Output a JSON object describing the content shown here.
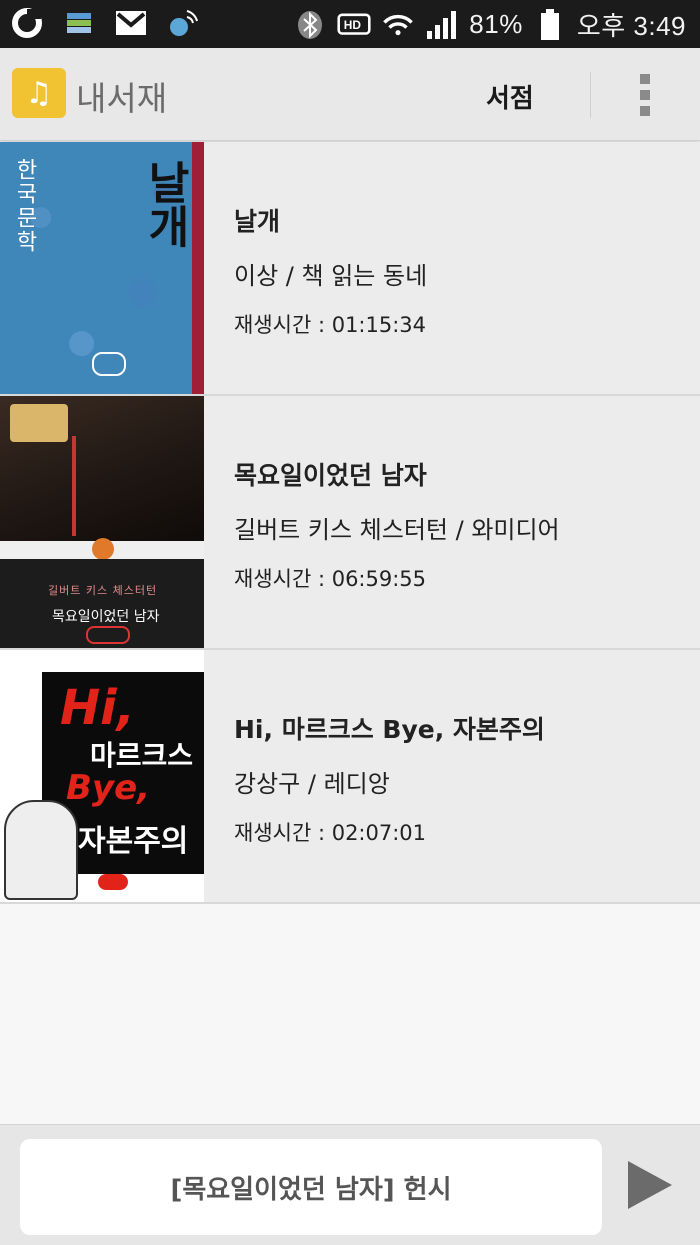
{
  "status_bar": {
    "battery_percent": "81%",
    "time": "오후 3:49",
    "icons": [
      "o-app-icon",
      "sync-icon",
      "gmail-icon",
      "signal-app-icon",
      "bluetooth-icon",
      "hd-icon",
      "wifi-icon",
      "cell-signal-icon",
      "battery-icon"
    ]
  },
  "app_bar": {
    "title": "내서재",
    "store_label": "서점",
    "logo_icon": "music-book-icon",
    "menu_icon": "overflow-menu-icon"
  },
  "books": [
    {
      "title": "날개",
      "author": "이상 / 책 읽는 동네",
      "play_time": "재생시간 : 01:15:34",
      "cover": {
        "series": "한국문학",
        "title": "날개"
      }
    },
    {
      "title": "목요일이었던 남자",
      "author": "길버트 키스 체스터턴 / 와미디어",
      "play_time": "재생시간 : 06:59:55",
      "cover": {
        "author": "길버트 키스 체스터턴",
        "title": "목요일이었던 남자"
      }
    },
    {
      "title": "Hi, 마르크스 Bye, 자본주의",
      "author": "강상구 / 레디앙",
      "play_time": "재생시간 : 02:07:01",
      "cover": {
        "hi": "Hi,",
        "marx": "마르크스",
        "bye": "Bye,",
        "capital": "자본주의"
      }
    }
  ],
  "player": {
    "now_playing": "[목요일이었던 남자] 헌시",
    "play_icon": "play-icon"
  },
  "colors": {
    "app_bar_bg": "#e8e8e8",
    "logo_yellow": "#f1c232",
    "list_bg": "#ececec",
    "status_bar_bg": "#1b1b1b"
  }
}
